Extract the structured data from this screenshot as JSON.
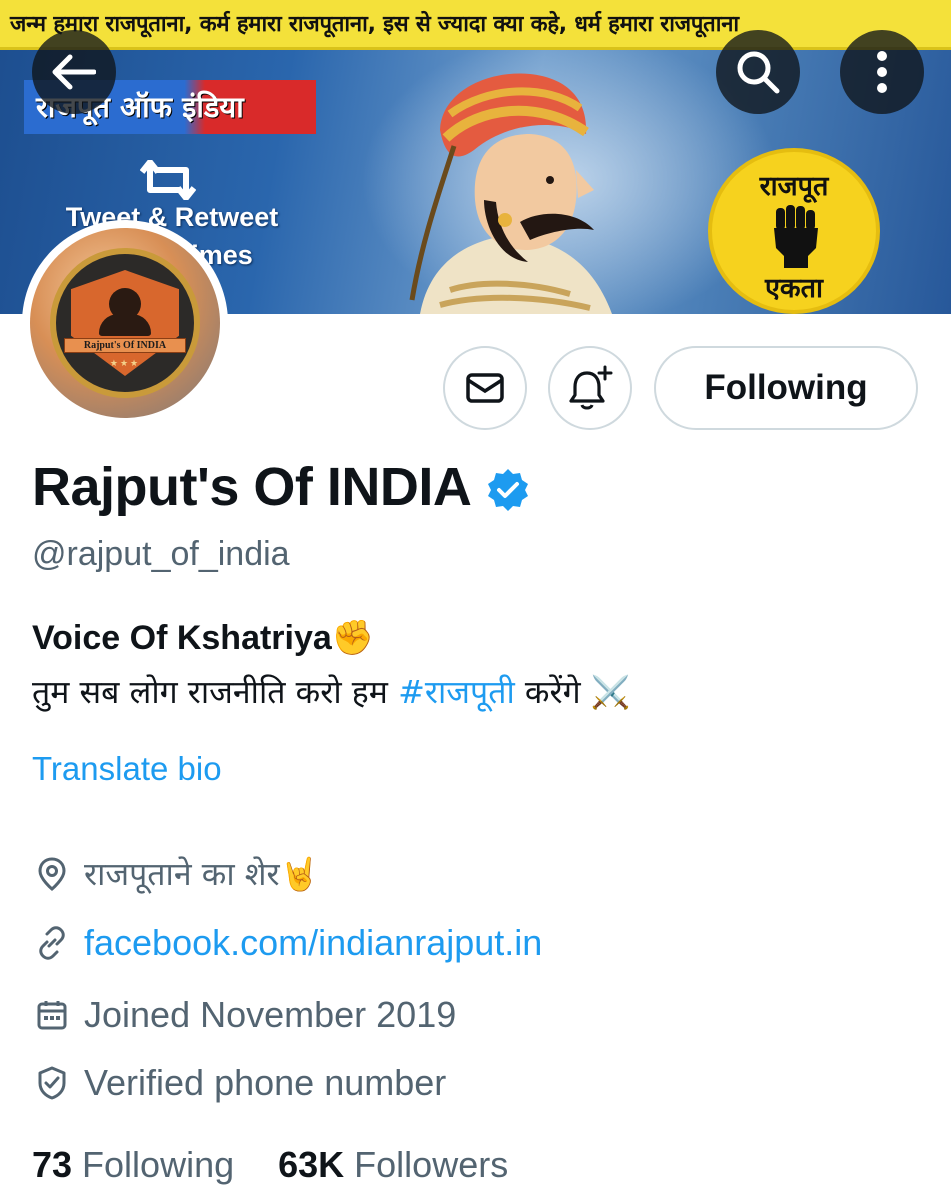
{
  "banner": {
    "strip_text": "जन्म हमारा राजपूताना, कर्म हमारा राजपूताना, इस से ज्यादा क्या कहे, धर्म हमारा राजपूताना",
    "tag_text": "राजपूत ऑफ इंडिया",
    "retweet_line1": "Tweet & Retweet",
    "retweet_line2": "imes",
    "badge_top": "राजपूत",
    "badge_bottom": "एकता",
    "colors": {
      "strip": "#f4e13a",
      "background": "#2a66ad",
      "badge": "#f6d21e"
    }
  },
  "header_buttons": {
    "back_icon": "arrow-left-icon",
    "search_icon": "search-icon",
    "more_icon": "more-vertical-icon"
  },
  "avatar": {
    "label": "Rajput's Of INDIA",
    "stars": "★★★"
  },
  "actions": {
    "message_icon": "envelope-icon",
    "notify_icon": "bell-plus-icon",
    "follow_label": "Following"
  },
  "profile": {
    "display_name": "Rajput's Of INDIA",
    "verified_icon": "verified-badge-icon",
    "handle": "@rajput_of_india",
    "bio_line1": "Voice Of Kshatriya✊",
    "bio_line2_prefix": "तुम सब लोग राजनीति करो हम ",
    "bio_hashtag": "#राजपूती",
    "bio_line2_suffix": " करेंगे ⚔️",
    "translate_label": "Translate bio",
    "location": "राजपूताने का शेर🤘",
    "website": "facebook.com/indianrajput.in",
    "joined": "Joined November 2019",
    "phone_status": "Verified phone number"
  },
  "stats": {
    "following_count": "73",
    "following_label": "Following",
    "followers_count": "63K",
    "followers_label": "Followers"
  },
  "colors": {
    "accent": "#1d9bf0",
    "text": "#0f1419",
    "muted": "#536471",
    "border": "#cfd9de"
  }
}
